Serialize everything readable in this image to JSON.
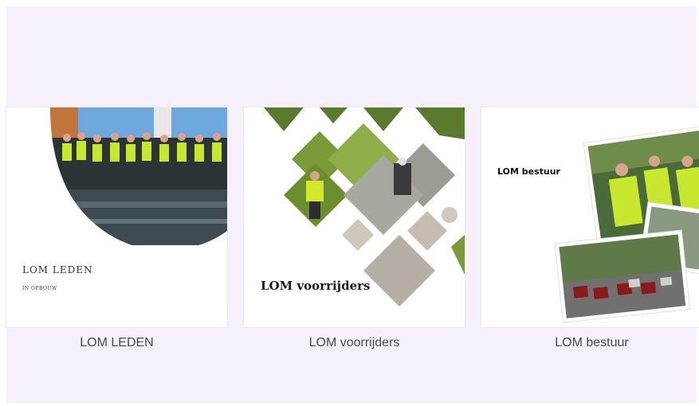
{
  "cards": [
    {
      "caption": "LOM LEDEN",
      "image_title": "LOM LEDEN",
      "image_subtitle": "IN OPBOUW"
    },
    {
      "caption": "LOM voorrijders",
      "image_title": "LOM voorrijders"
    },
    {
      "caption": "LOM bestuur",
      "image_title": "LOM bestuur"
    }
  ],
  "colors": {
    "panel_background": "#f6f0fb",
    "card_background": "#ffffff",
    "caption_text": "#4a4a4a",
    "safety_vest": "#c8e830"
  }
}
